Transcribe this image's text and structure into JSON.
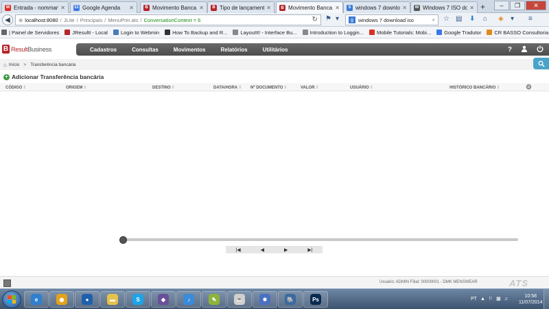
{
  "browser": {
    "tabs": [
      {
        "label": "Entrada - nomman...",
        "icon": "gmail-icon",
        "color": "#d93025",
        "glyph": "M"
      },
      {
        "label": "Google Agenda",
        "icon": "calendar-icon",
        "color": "#3b78e7",
        "glyph": "31"
      },
      {
        "label": "Movimento Banca...",
        "icon": "result-icon",
        "color": "#b5252b",
        "glyph": "B"
      },
      {
        "label": "Tipo de lançament...",
        "icon": "result-icon",
        "color": "#b5252b",
        "glyph": "B"
      },
      {
        "label": "Movimento Banca...",
        "icon": "result-icon",
        "color": "#b5252b",
        "glyph": "B"
      },
      {
        "label": "windows 7 downlo...",
        "icon": "search-icon",
        "color": "#3a78d6",
        "glyph": "S"
      },
      {
        "label": "Windows 7 ISO do...",
        "icon": "page-icon",
        "color": "#555555",
        "glyph": "W"
      }
    ],
    "active_tab": 4,
    "new_tab": "+",
    "url": {
      "host": "localhost:8080",
      "segments": [
        "JLite",
        "Principais",
        "MenuPrin.ats"
      ],
      "context": "ConversationContext = 6"
    },
    "search_value": "windows 7 download iso",
    "bookmarks": [
      {
        "label": "| Painel de Servidores",
        "color": "#666666"
      },
      {
        "label": "JResultt - Local",
        "color": "#b5252b"
      },
      {
        "label": "Login to Webmin",
        "color": "#4b7bb8"
      },
      {
        "label": "How To Backup and R...",
        "color": "#333333"
      },
      {
        "label": "LayoutIt! - Interface Bu...",
        "color": "#888888"
      },
      {
        "label": "Introduction to Loggin...",
        "color": "#888888"
      },
      {
        "label": "Mobile Tutorials: Mobi...",
        "color": "#d93025"
      },
      {
        "label": "Google Tradutor",
        "color": "#3b78e7"
      },
      {
        "label": "CR BASSO Consultoria...",
        "color": "#e08a1e"
      }
    ]
  },
  "app": {
    "logo_brand": "Result",
    "logo_suffix": "Business",
    "menu": [
      "Cadastros",
      "Consultas",
      "Movimentos",
      "Relatórios",
      "Utilitários"
    ],
    "breadcrumb": [
      "Início",
      "Transferência bancária"
    ],
    "page_title": "Adicionar Transferência bancária",
    "columns": [
      "CÓDIGO",
      "ORIGEM",
      "DESTINO",
      "DATA/HORA",
      "Nº DOCUMENTO",
      "VALOR",
      "USUÁRIO",
      "HISTÓRICO BANCÁRIO"
    ],
    "pager": {
      "first": "|◀",
      "prev": "◀",
      "next": "▶",
      "last": "▶|"
    },
    "status": "Usuário: ADMIN   Filial: 00000001 - DMK MENSWEAR",
    "vendor_logo": "ATS"
  },
  "taskbar": {
    "apps": [
      {
        "icon": "explorer-icon",
        "color": "#2f7fd1",
        "glyph": "e"
      },
      {
        "icon": "chrome-icon",
        "color": "#e2a21a",
        "glyph": "◉"
      },
      {
        "icon": "firefox-icon",
        "color": "#1f5fae",
        "glyph": "●"
      },
      {
        "icon": "folder-icon",
        "color": "#e7c24a",
        "glyph": "▬"
      },
      {
        "icon": "skype-icon",
        "color": "#1ca4e8",
        "glyph": "S"
      },
      {
        "icon": "gimp-icon",
        "color": "#6b4f9a",
        "glyph": "◆"
      },
      {
        "icon": "itunes-icon",
        "color": "#3a8bd8",
        "glyph": "♪"
      },
      {
        "icon": "note-icon",
        "color": "#8cb43c",
        "glyph": "✎"
      },
      {
        "icon": "java-icon",
        "color": "#d0d0d0",
        "glyph": "☕"
      },
      {
        "icon": "network-icon",
        "color": "#4a70c4",
        "glyph": "✸"
      },
      {
        "icon": "postgres-icon",
        "color": "#3b6aa0",
        "glyph": "🐘"
      },
      {
        "icon": "photoshop-icon",
        "color": "#0a2a4f",
        "glyph": "Ps"
      }
    ],
    "language": "PT",
    "time": "10:58",
    "date": "11/07/2014"
  }
}
